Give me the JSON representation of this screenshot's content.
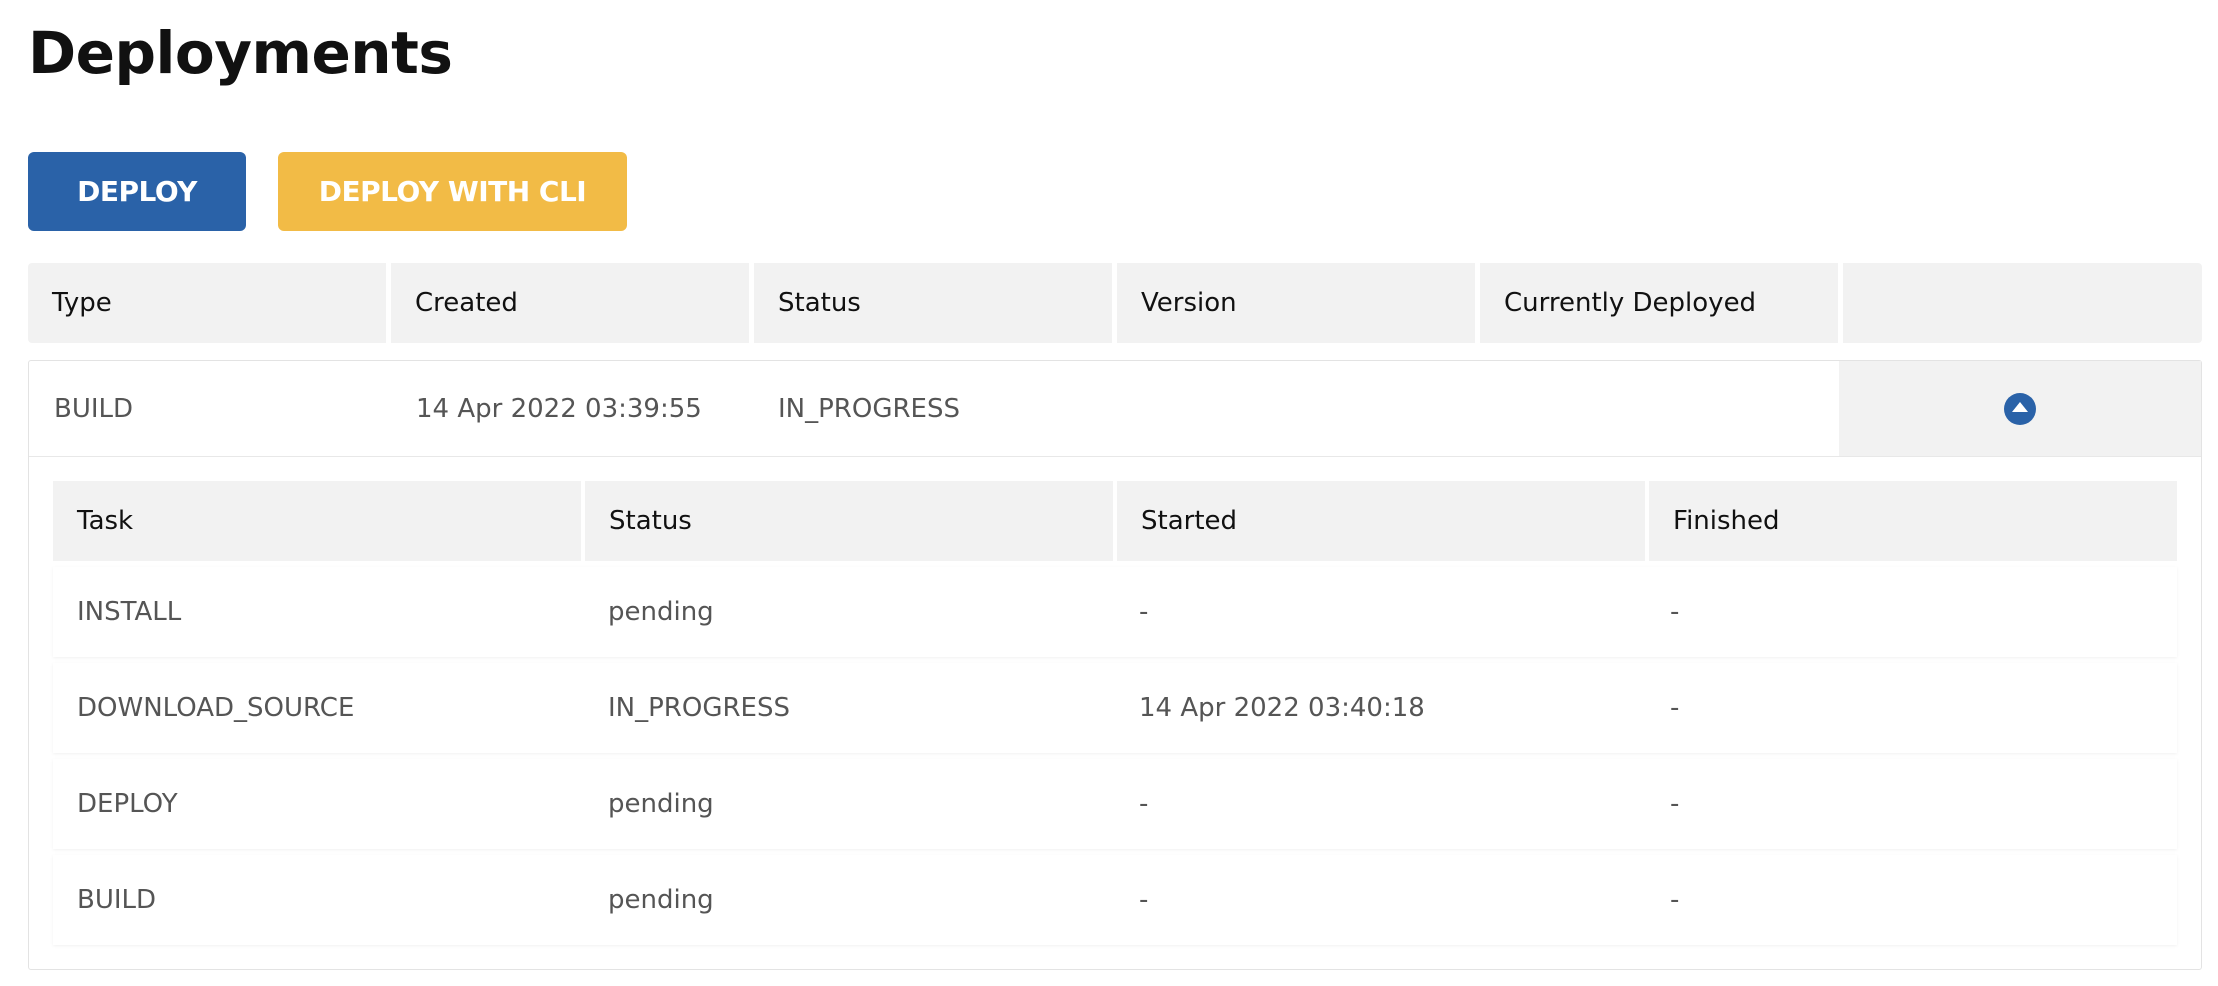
{
  "page": {
    "title": "Deployments"
  },
  "toolbar": {
    "deploy_label": "DEPLOY",
    "deploy_cli_label": "DEPLOY WITH CLI"
  },
  "deployments": {
    "columns": [
      "Type",
      "Created",
      "Status",
      "Version",
      "Currently Deployed",
      ""
    ],
    "rows": [
      {
        "type": "BUILD",
        "created": "14 Apr 2022 03:39:55",
        "status": "IN_PROGRESS",
        "version": "",
        "currently_deployed": "",
        "expanded": true
      }
    ]
  },
  "tasks": {
    "columns": [
      "Task",
      "Status",
      "Started",
      "Finished"
    ],
    "rows": [
      {
        "task": "INSTALL",
        "status": "pending",
        "started": "-",
        "finished": "-"
      },
      {
        "task": "DOWNLOAD_SOURCE",
        "status": "IN_PROGRESS",
        "started": "14 Apr 2022 03:40:18",
        "finished": "-"
      },
      {
        "task": "DEPLOY",
        "status": "pending",
        "started": "-",
        "finished": "-"
      },
      {
        "task": "BUILD",
        "status": "pending",
        "started": "-",
        "finished": "-"
      }
    ]
  },
  "icons": {
    "toggle": "chevron-up-circle-icon"
  },
  "colors": {
    "primary": "#2a62a8",
    "secondary": "#f2bb46",
    "header_bg": "#f2f2f2"
  }
}
